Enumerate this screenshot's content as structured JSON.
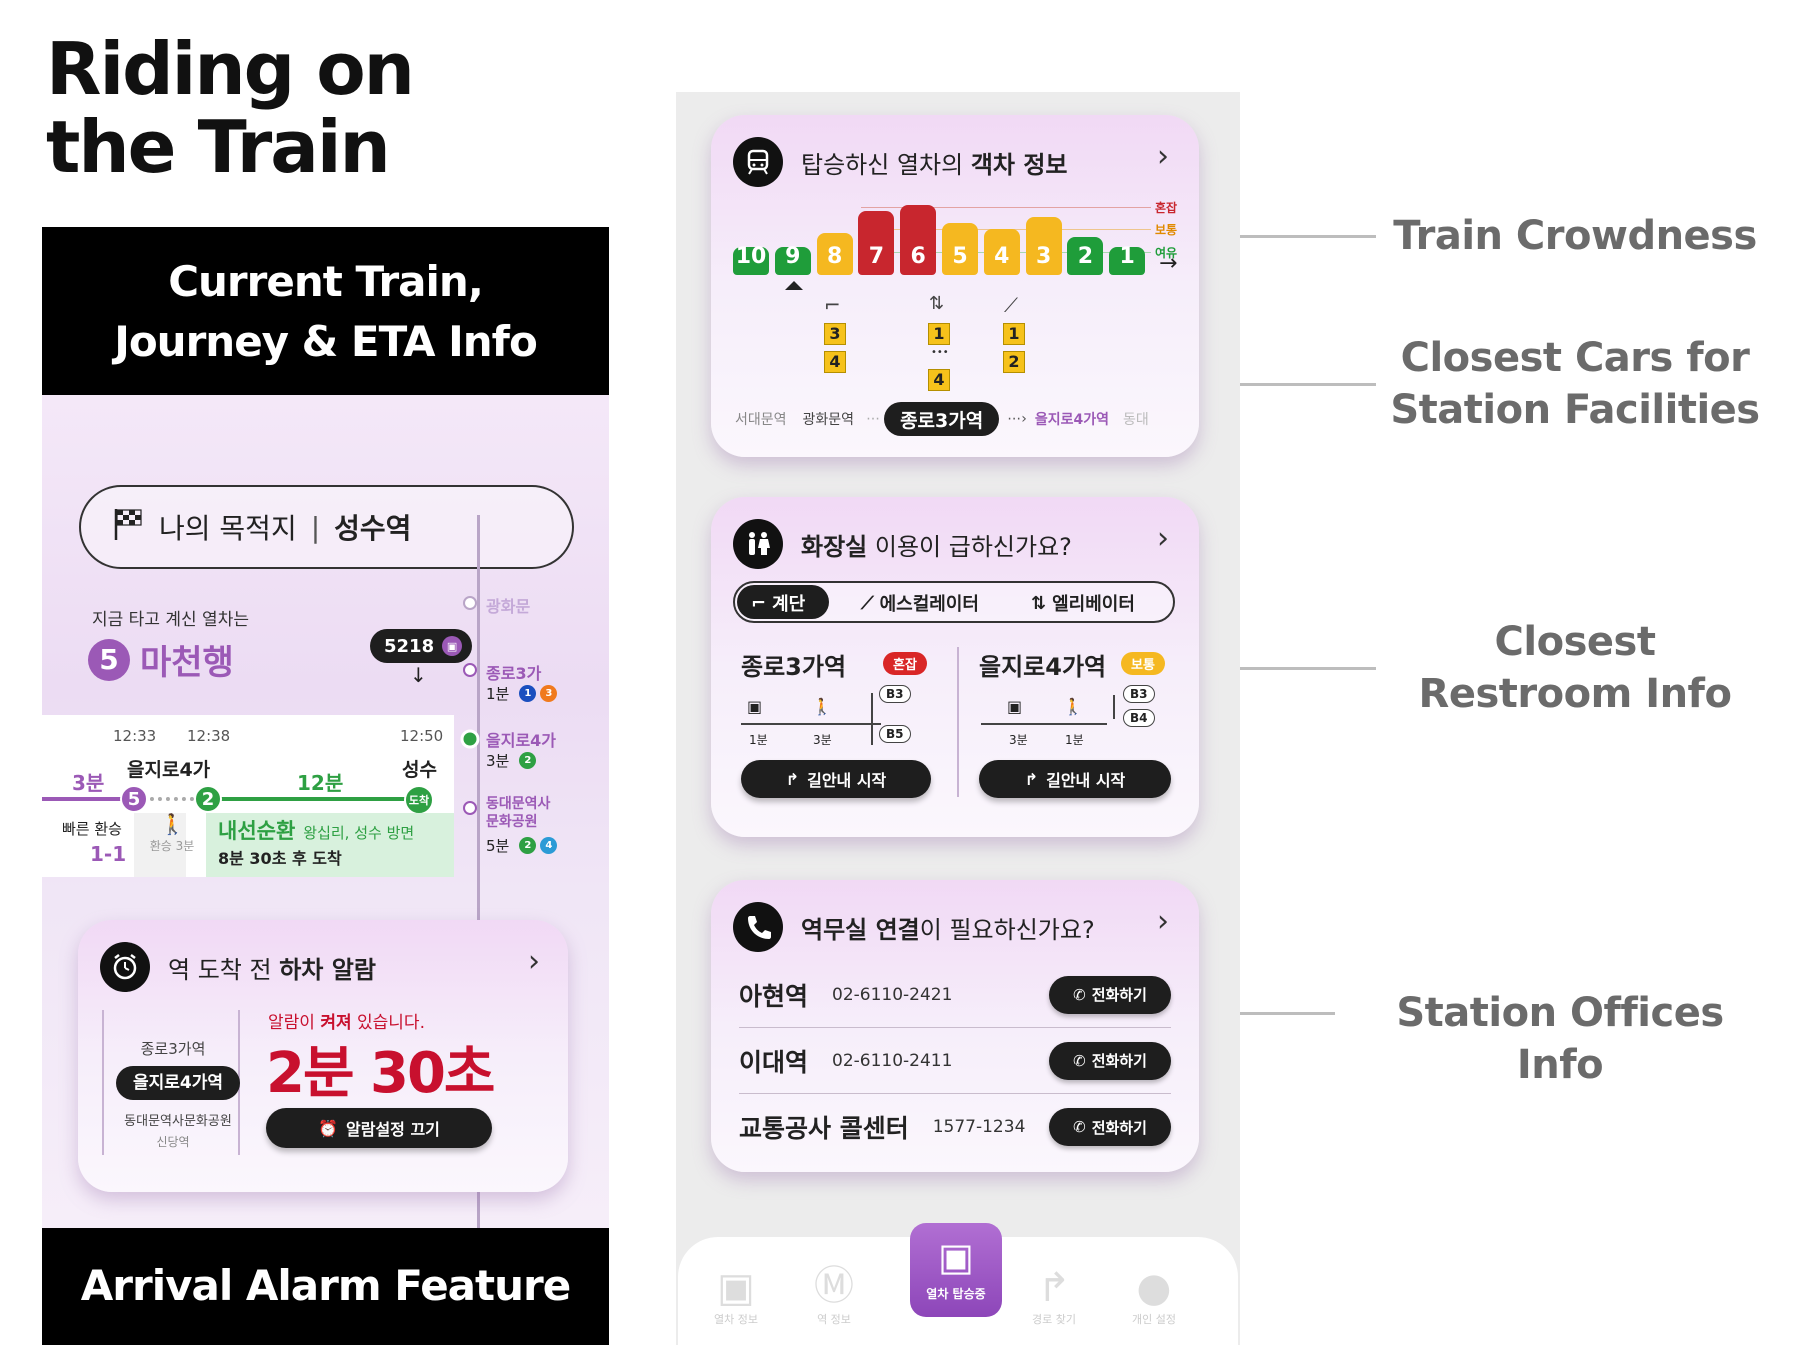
{
  "title": {
    "line1": "Riding on",
    "line2": "the Train"
  },
  "bands": {
    "top_line1": "Current Train,",
    "top_line2": "Journey & ETA Info",
    "bottom": "Arrival Alarm Feature"
  },
  "callouts": {
    "crowd": "Train Crowdness",
    "facilities_1": "Closest Cars for",
    "facilities_2": "Station Facilities",
    "restroom_1": "Closest",
    "restroom_2": "Restroom Info",
    "offices": "Station Offices Info"
  },
  "colors": {
    "line5": "#9b59b6",
    "line2": "#2ea043",
    "red": "#c8102e",
    "crowd_red": "#c8262e",
    "crowd_yellow": "#f5b820",
    "crowd_green": "#1f9d3a"
  },
  "journey": {
    "dest_label": "나의 목적지",
    "dest_sep": "|",
    "dest_value": "성수역",
    "current_label": "지금 타고 계신 열차는",
    "line_num": "5",
    "direction": "마천행",
    "train_no": "5218",
    "arrow": "↓",
    "stations": [
      {
        "name": "광화문",
        "info": "",
        "badges": []
      },
      {
        "name": "종로3가",
        "info": "1분",
        "badges": [
          "1",
          "3"
        ]
      },
      {
        "name": "을지로4가",
        "info": "3분",
        "badges": [
          "2"
        ]
      },
      {
        "name": "동대문역사",
        "name2": "문화공원",
        "info": "5분",
        "badges": [
          "2",
          "4"
        ]
      }
    ],
    "times": [
      "12:33",
      "12:38",
      "12:50"
    ],
    "seg1": "3분",
    "transfer_station": "을지로4가",
    "seg2": "12분",
    "end_station": "성수",
    "fast_transfer": "빠른 환승",
    "fast_car": "1-1",
    "walk": "환승 3분",
    "line2_name": "내선순환",
    "line2_dir": "왕십리, 성수 방면",
    "arrive_eta": "8분 30초 후 도착",
    "arrive_tag": "도착",
    "n5": "5",
    "n2": "2"
  },
  "alarm": {
    "title_pre": "역 도착 전 ",
    "title_bold": "하차 알람",
    "chev": "›",
    "stations": [
      "종로3가역",
      "을지로4가역",
      "동대문역사문화공원",
      "신당역"
    ],
    "status_pre": "알람이 ",
    "status_bold": "켜져",
    "status_post": " 있습니다.",
    "countdown": "2분 30초",
    "button": "알람설정 끄기"
  },
  "crowd": {
    "title_pre": "탑승하신 열차의 ",
    "title_bold": "객차 정보",
    "chev": "›",
    "levels": [
      "혼잡",
      "보통",
      "여유"
    ],
    "cars": [
      {
        "n": "10",
        "level": "green",
        "h": 28
      },
      {
        "n": "9",
        "level": "green",
        "h": 28
      },
      {
        "n": "8",
        "level": "yellow",
        "h": 42
      },
      {
        "n": "7",
        "level": "red",
        "h": 64
      },
      {
        "n": "6",
        "level": "red",
        "h": 70
      },
      {
        "n": "5",
        "level": "yellow",
        "h": 52
      },
      {
        "n": "4",
        "level": "yellow",
        "h": 46
      },
      {
        "n": "3",
        "level": "yellow",
        "h": 58
      },
      {
        "n": "2",
        "level": "green",
        "h": 38
      },
      {
        "n": "1",
        "level": "green",
        "h": 28
      }
    ],
    "arrow": "→",
    "fac1": [
      "3",
      "4"
    ],
    "fac2": [
      "1",
      "4"
    ],
    "fac2_dots": "•••",
    "fac3": [
      "1",
      "2"
    ],
    "stations": [
      "서대문역",
      "광화문역",
      "종로3가역",
      "을지로4가역",
      "동대"
    ]
  },
  "restroom": {
    "title_bold": "화장실",
    "title_post": " 이용이 급하신가요?",
    "chev": "›",
    "tabs": [
      "계단",
      "에스컬레이터",
      "엘리베이터"
    ],
    "left": {
      "name": "종로3가역",
      "badge": "혼잡",
      "t1": "1분",
      "t2": "3분",
      "b1": "B3",
      "b2": "B5",
      "btn": "길안내 시작"
    },
    "right": {
      "name": "을지로4가역",
      "badge": "보통",
      "t1": "3분",
      "t2": "1분",
      "b1": "B3",
      "b2": "B4",
      "btn": "길안내 시작"
    }
  },
  "office": {
    "title_bold": "역무실 연결",
    "title_post": "이 필요하신가요?",
    "chev": "›",
    "rows": [
      {
        "name": "아현역",
        "phone": "02-6110-2421",
        "btn": "전화하기"
      },
      {
        "name": "이대역",
        "phone": "02-6110-2411",
        "btn": "전화하기"
      },
      {
        "name": "교통공사 콜센터",
        "phone": "1577-1234",
        "btn": "전화하기"
      }
    ]
  },
  "tabbar": [
    "열차 정보",
    "역 정보",
    "열차 탑승중",
    "경로 찾기",
    "개인 설정"
  ]
}
